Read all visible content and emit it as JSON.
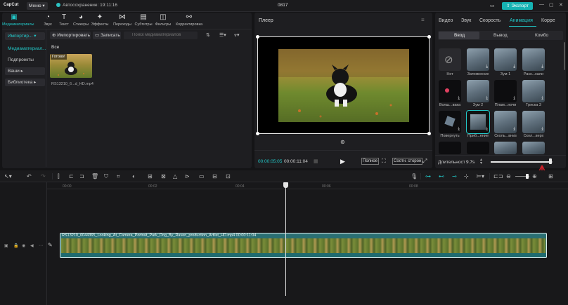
{
  "app": {
    "logo": "CapCut",
    "menu": "Меню",
    "autosave": "Автосохранение: 19:11:16",
    "project_title": "0817",
    "export": "Экспорт",
    "accent": "#22c7c7"
  },
  "toolbar": {
    "tools": [
      {
        "label": "Медиаматериалы",
        "icon": "media-icon"
      },
      {
        "label": "Звук",
        "icon": "audio-icon"
      },
      {
        "label": "Текст",
        "icon": "text-icon"
      },
      {
        "label": "Стикеры",
        "icon": "sticker-icon"
      },
      {
        "label": "Эффекты",
        "icon": "effects-icon"
      },
      {
        "label": "Переходы",
        "icon": "transition-icon"
      },
      {
        "label": "Субтитры",
        "icon": "subtitles-icon"
      },
      {
        "label": "Фильтры",
        "icon": "filter-icon"
      },
      {
        "label": "Корректировка",
        "icon": "adjust-icon"
      }
    ]
  },
  "media_sidebar": {
    "items": [
      "Импортир...",
      "Медиаматериал...",
      "Подпроекты",
      "Ваши",
      "Библиотека"
    ]
  },
  "media": {
    "import": "Импортировать",
    "record": "Записать",
    "search_placeholder": "Поиск медиаматериалов",
    "all": "Все",
    "thumb_badge": "Готово!",
    "thumb_name": "RS13210_6...d_HD.mp4"
  },
  "player": {
    "title": "Плеер",
    "time_current": "00:00:05:05",
    "time_total": "00:00:11:04",
    "full": "Полное",
    "ratio": "Соотн. сторон"
  },
  "inspector": {
    "tabs": [
      "Видео",
      "Звук",
      "Скорость",
      "Анимация",
      "Корре"
    ],
    "active_tab": "Анимация",
    "segments": [
      "Ввод",
      "Вывод",
      "Комбо"
    ],
    "animations": [
      {
        "label": "Нет"
      },
      {
        "label": "Затемнение"
      },
      {
        "label": "Зум 1"
      },
      {
        "label": "Раск...кали"
      },
      {
        "label": "Волш...вака"
      },
      {
        "label": "Зум 2"
      },
      {
        "label": "Плам...ночи"
      },
      {
        "label": "Тряска 3"
      },
      {
        "label": "Повернуть"
      },
      {
        "label": "Приб...ение"
      },
      {
        "label": "Сколь...вниз"
      },
      {
        "label": "Скол...верх"
      }
    ],
    "duration_label": "Длительност",
    "duration_value": "9.7s",
    "duration_fraction": 0.97
  },
  "timeline": {
    "ruler": [
      "00:00",
      "00:02",
      "00:04",
      "00:06",
      "00:08"
    ],
    "clip_label": "RS13210_6044365_Looking_At_Camera_Portrait_Park_Dog_By_Raven_production_Artlist_HD.mp4   00:00:11:04"
  }
}
